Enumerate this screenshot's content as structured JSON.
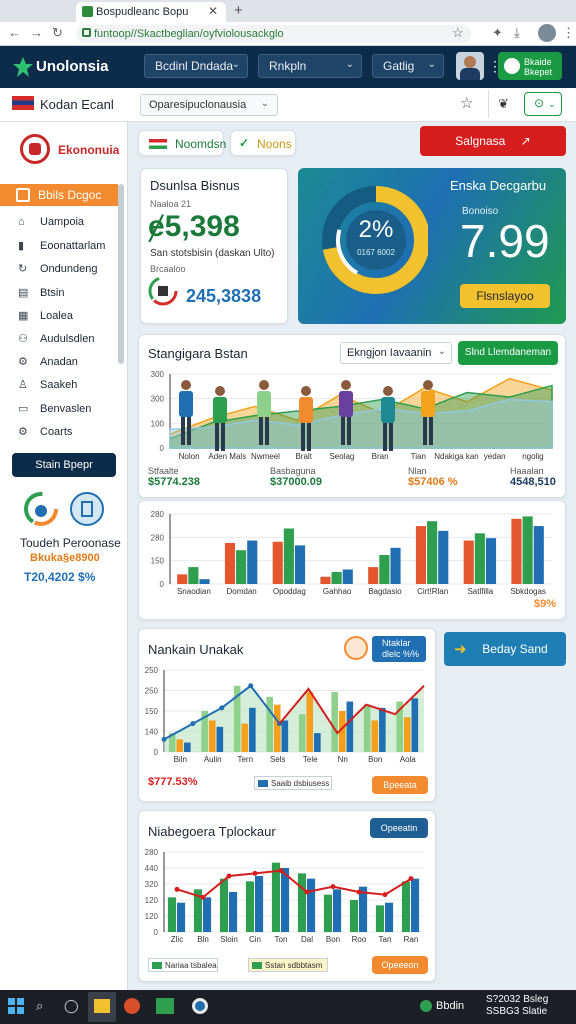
{
  "browser": {
    "tab_title": "Bospudleanc Bopu",
    "url": "funtoop//Skactbeglian/oyfviolousackglo"
  },
  "header": {
    "brand": "Unolonsia",
    "dropdowns": [
      "Bcdinl Dndada",
      "Rnkpln",
      "Gatlig"
    ],
    "button_label_1": "Bkaide",
    "button_label_2": "Bkepet"
  },
  "subbar": {
    "title": "Kodan Ecanl",
    "select_value": "Oparesipuclonausia"
  },
  "sidebar": {
    "brand": "Ekononuia",
    "active": "Bbils Dcgoc",
    "items": [
      {
        "label": "Uampoia",
        "icon": "home-icon"
      },
      {
        "label": "Eoonattarlam",
        "icon": "chart-icon"
      },
      {
        "label": "Ondundeng",
        "icon": "refresh-icon"
      },
      {
        "label": "Btsin",
        "icon": "calendar-icon"
      },
      {
        "label": "Loalea",
        "icon": "table-icon"
      },
      {
        "label": "Audulsdlen",
        "icon": "people-icon"
      },
      {
        "label": "Anadan",
        "icon": "gear-icon"
      },
      {
        "label": "Saakeh",
        "icon": "person-icon"
      },
      {
        "label": "Benvaslen",
        "icon": "message-icon"
      },
      {
        "label": "Coarts",
        "icon": "gear-icon"
      }
    ],
    "button": "Stain Bpepr",
    "footer_title": "Toudeh Peroonase",
    "footer_sub": "Bkuka§e8900",
    "footer_value": "T20,4202 $%"
  },
  "top_tabs": {
    "tab1": "Noomdsn",
    "tab2": "Noons",
    "action": "Salgnasa"
  },
  "kpi": {
    "title": "Dsunlsa Bisnus",
    "sub": "Naaloa 21",
    "value": "ɇ5,398",
    "desc": "San stotsbisin (daskan Ulto)",
    "sub2": "Brcaaloo",
    "value2": "245,3838"
  },
  "highlight": {
    "title": "Enska Decgarbu",
    "label": "Bonoiso",
    "value": "7.99",
    "donut_pct": "2%",
    "donut_sub": "0167 6002",
    "button": "Flsnslayoo",
    "donut_fraction": 0.72
  },
  "card1": {
    "title": "Stangigara Bstan",
    "dropdown": "Ekngjon Iavaanin",
    "button": "Slnd Llemdaneman",
    "stats": [
      {
        "label": "Stfaalte",
        "value": "$5774.238"
      },
      {
        "label": "Basbaguna",
        "value": "$37000.09"
      },
      {
        "label": "Nlan",
        "value": "$57406 %"
      },
      {
        "label": "Haaalan",
        "value": "4548,510"
      }
    ],
    "footnote": "$9%"
  },
  "card2": {
    "title": "Nankain Unakak",
    "badge1": "Ntaklar",
    "badge2": "dlelc %%",
    "side_button": "Beday Sand",
    "footer_value": "$777.53%",
    "footer_legend": "Saaib dsbiusess",
    "footer_button": "Bpeeata"
  },
  "card3": {
    "title": "Niabegoera Tplockaur",
    "button": "Opeeatin",
    "legend1": "Nariaa tsbalea",
    "legend2": "Sstan sdbbtasm",
    "footer_button": "Opeeeon"
  },
  "taskbar": {
    "status_label": "Bbdin",
    "clock_line1": "S?2032 Bsleg",
    "clock_line2": "SSBG3 Slatie"
  },
  "chart_data": [
    {
      "type": "area",
      "title": "Stangigara Bstan",
      "categories": [
        "Nolon",
        "Aden Mals",
        "Nwmeel",
        "Bralt",
        "Seolag",
        "Bran",
        "Tian",
        "Ndakiga kan",
        "yedan",
        "ngolig"
      ],
      "yticks": [
        0,
        100,
        300,
        300
      ],
      "ylim": [
        0,
        320
      ],
      "series": [
        {
          "values": [
            60,
            130,
            180,
            120,
            230,
            150,
            260,
            200,
            300,
            250
          ],
          "color": "#f2a21b"
        },
        {
          "values": [
            40,
            110,
            140,
            160,
            180,
            210,
            170,
            240,
            220,
            270
          ],
          "color": "#2e9e4f"
        },
        {
          "values": [
            80,
            90,
            120,
            100,
            140,
            170,
            150,
            160,
            210,
            200
          ],
          "color": "#8ec8e0"
        }
      ]
    },
    {
      "type": "bar",
      "title": "",
      "categories": [
        "Snaodian",
        "Domdan",
        "Opoddag",
        "Gahhao",
        "Bagdasio",
        "Cirt!Rlan",
        "Satlfilla",
        "Sbkdogas"
      ],
      "yticks": [
        0,
        150,
        280,
        280
      ],
      "ylim": [
        0,
        290
      ],
      "series": [
        {
          "values": [
            40,
            170,
            175,
            30,
            70,
            240,
            180,
            270
          ],
          "color": "#e4572e"
        },
        {
          "values": [
            70,
            140,
            230,
            50,
            120,
            260,
            210,
            280
          ],
          "color": "#2e9e4f"
        },
        {
          "values": [
            20,
            180,
            160,
            60,
            150,
            220,
            190,
            240
          ],
          "color": "#1f6fb2"
        }
      ]
    },
    {
      "type": "bar",
      "title": "Nankain Unakak",
      "categories": [
        "Biln",
        "Aulin",
        "Tern",
        "Sels",
        "Tele",
        "Nn",
        "Bon",
        "Aola"
      ],
      "yticks": [
        0,
        140,
        150,
        250,
        250
      ],
      "ylim": [
        0,
        260
      ],
      "series": [
        {
          "values": [
            60,
            130,
            210,
            175,
            120,
            190,
            150,
            160
          ],
          "color": "#8fd18a"
        },
        {
          "values": [
            40,
            100,
            90,
            150,
            190,
            130,
            100,
            110
          ],
          "color": "#f59f1c"
        },
        {
          "values": [
            30,
            80,
            140,
            100,
            60,
            160,
            140,
            170
          ],
          "color": "#1f6fb2"
        }
      ],
      "line": [
        40,
        90,
        140,
        210,
        90,
        200,
        60,
        150,
        120,
        210
      ]
    },
    {
      "type": "bar",
      "title": "Niabegoera Tplockaur",
      "categories": [
        "Zlic",
        "Bln",
        "Sloin",
        "Cin",
        "Ton",
        "Dal",
        "Bon",
        "Roo",
        "Tan",
        "Ran"
      ],
      "yticks": [
        0,
        120,
        120,
        320,
        440,
        280
      ],
      "ylim": [
        0,
        300
      ],
      "series": [
        {
          "values": [
            130,
            160,
            200,
            190,
            260,
            220,
            140,
            120,
            100,
            190
          ],
          "color": "#2e9e4f"
        },
        {
          "values": [
            110,
            130,
            150,
            210,
            240,
            200,
            160,
            170,
            110,
            200
          ],
          "color": "#1f6fb2"
        }
      ],
      "line": [
        160,
        130,
        210,
        220,
        230,
        150,
        170,
        150,
        140,
        200
      ]
    }
  ]
}
